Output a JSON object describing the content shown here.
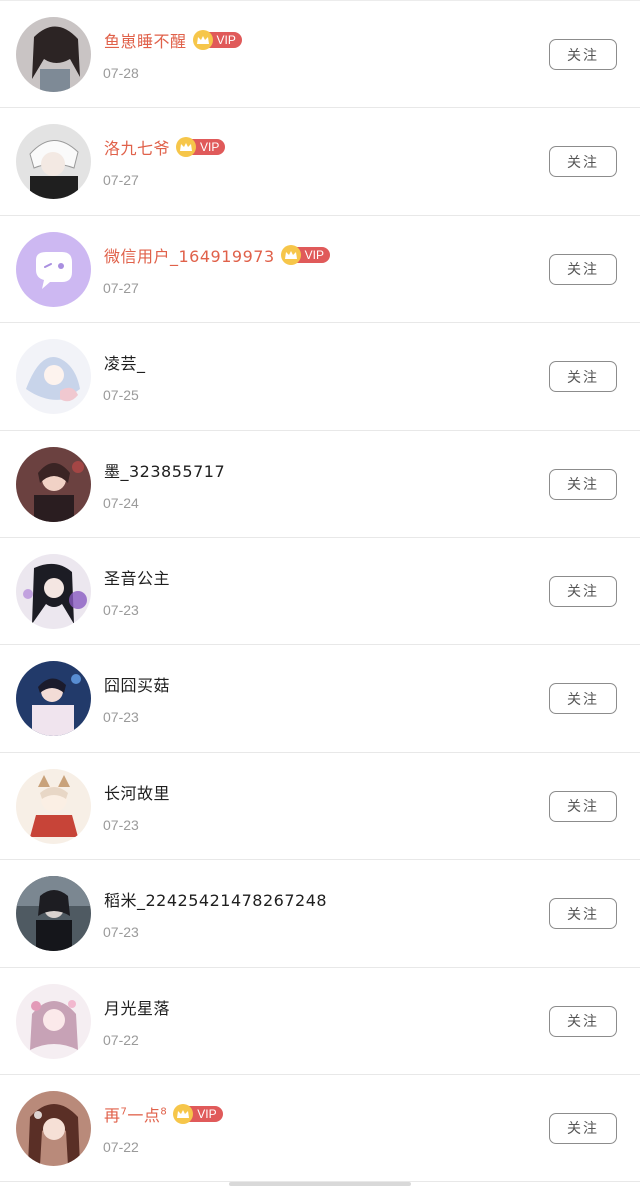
{
  "follow_label": "关注",
  "vip_label": "VIP",
  "colors": {
    "vip_name": "#e0614a",
    "vip_badge": "#e05a5a",
    "crown": "#f6c64a"
  },
  "users": [
    {
      "name": "鱼崽睡不醒",
      "date": "07-28",
      "vip": true,
      "avatar": "girl-photo"
    },
    {
      "name": "洛九七爷",
      "date": "07-27",
      "vip": true,
      "avatar": "anime-white-hair"
    },
    {
      "name": "微信用户_164919973",
      "date": "07-27",
      "vip": true,
      "avatar": "wechat-default"
    },
    {
      "name": "凌芸_",
      "date": "07-25",
      "vip": false,
      "avatar": "anime-pale"
    },
    {
      "name": "墨_323855717",
      "date": "07-24",
      "vip": false,
      "avatar": "anime-red"
    },
    {
      "name": "圣音公主",
      "date": "07-23",
      "vip": false,
      "avatar": "anime-dark-purple"
    },
    {
      "name": "囧囧买菇",
      "date": "07-23",
      "vip": false,
      "avatar": "anime-blue"
    },
    {
      "name": "长河故里",
      "date": "07-23",
      "vip": false,
      "avatar": "anime-chibi"
    },
    {
      "name": "稻米_22425421478267248",
      "date": "07-23",
      "vip": false,
      "avatar": "anime-dark"
    },
    {
      "name": "月光星落",
      "date": "07-22",
      "vip": false,
      "avatar": "anime-pink"
    },
    {
      "name": "再",
      "name_sup_1": "7",
      "name_mid": "一点",
      "name_sup_2": "8",
      "date": "07-22",
      "vip": true,
      "avatar": "anime-brown-hair"
    }
  ]
}
